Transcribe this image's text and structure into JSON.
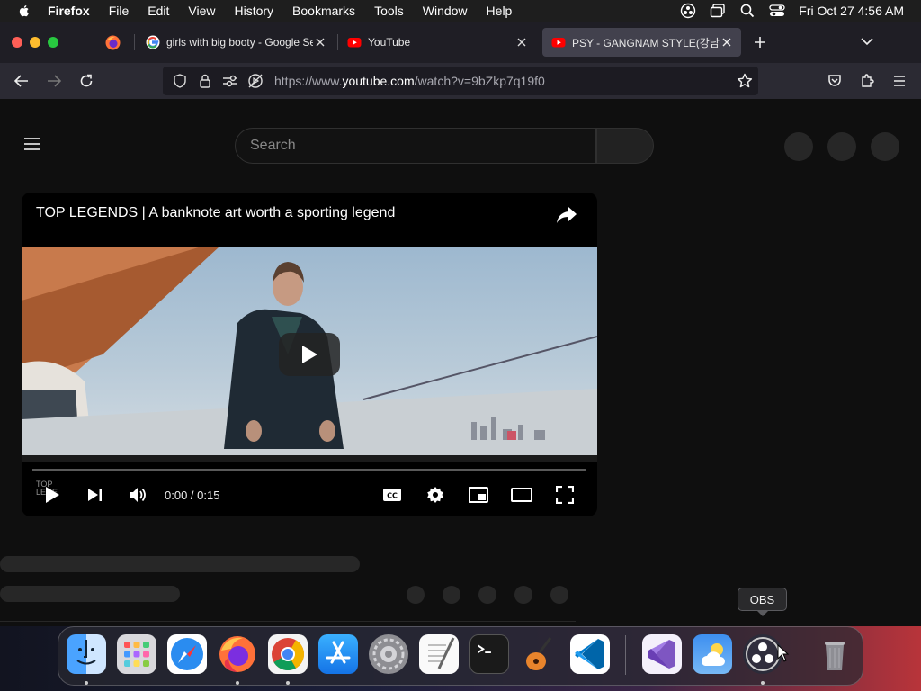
{
  "menubar": {
    "items": [
      "Firefox",
      "File",
      "Edit",
      "View",
      "History",
      "Bookmarks",
      "Tools",
      "Window",
      "Help"
    ],
    "clock": "Fri Oct 27  4:56 AM"
  },
  "tabs": [
    {
      "label": "girls with big booty - Google Se",
      "icon": "google-icon"
    },
    {
      "label": "YouTube",
      "icon": "youtube-icon"
    },
    {
      "label": "PSY - GANGNAM STYLE(강남스타",
      "icon": "youtube-icon",
      "active": true
    }
  ],
  "url": {
    "prefix": "https://www.",
    "host": "youtube.com",
    "path": "/watch?v=9bZkp7q19f0"
  },
  "youtube": {
    "search_placeholder": "Search"
  },
  "player": {
    "title": "TOP LEGENDS | A banknote art worth a sporting legend",
    "time": "0:00 / 0:15",
    "watermark_line1": "TOP",
    "watermark_line2": "LEGE",
    "progress_fraction": 0
  },
  "dock": {
    "tooltip": "OBS",
    "apps": [
      "finder",
      "launchpad",
      "safari",
      "firefox",
      "chrome",
      "app-store",
      "system-settings",
      "textedit",
      "terminal",
      "garageband",
      "vscode",
      "visual-studio",
      "weather",
      "obs",
      "trash"
    ]
  },
  "colors": {
    "youtube_red": "#ff0000",
    "active_tab": "#42414d",
    "yt_background": "#0f0f0f"
  }
}
